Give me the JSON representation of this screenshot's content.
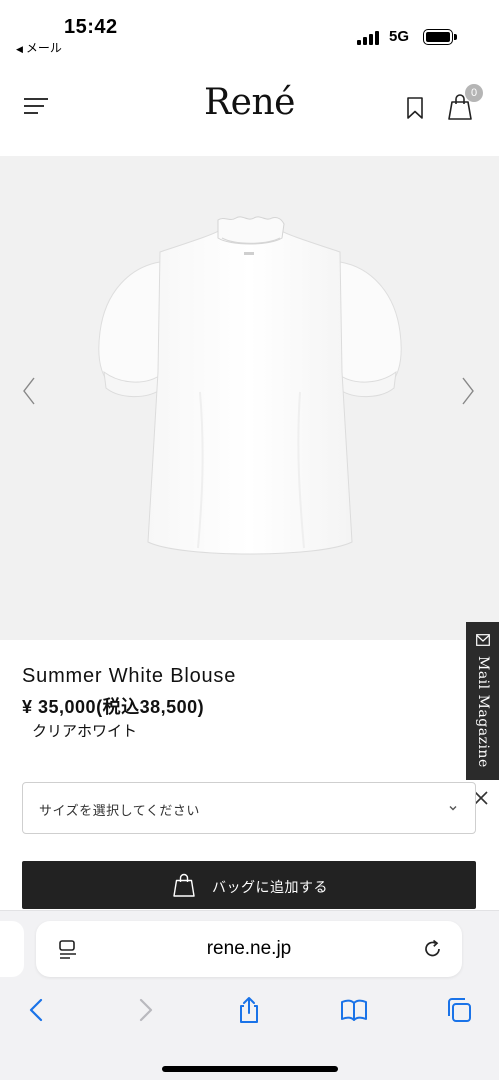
{
  "status_bar": {
    "time": "15:42",
    "back_app": "メール",
    "network": "5G"
  },
  "header": {
    "logo": "René",
    "bag_count": "0"
  },
  "gallery": {
    "image_alt": "white blouse product photo"
  },
  "mail_magazine": {
    "label": "Mail Magazine"
  },
  "product": {
    "name": "Summer White Blouse",
    "price": "¥ 35,000",
    "price_tax": "(税込38,500)",
    "color": "クリアホワイト",
    "size_placeholder": "サイズを選択してください",
    "add_to_bag": "バッグに追加する"
  },
  "browser": {
    "url": "rene.ne.jp",
    "accent_color": "#1a73e8"
  },
  "icons": [
    "menu-icon",
    "bookmark-icon",
    "bag-icon",
    "chevron-left-icon",
    "chevron-right-icon",
    "mail-icon",
    "close-icon",
    "chevron-down-icon",
    "page-menu-icon",
    "reload-icon",
    "back-icon",
    "forward-icon",
    "share-icon",
    "bookmarks-icon",
    "tabs-icon"
  ]
}
